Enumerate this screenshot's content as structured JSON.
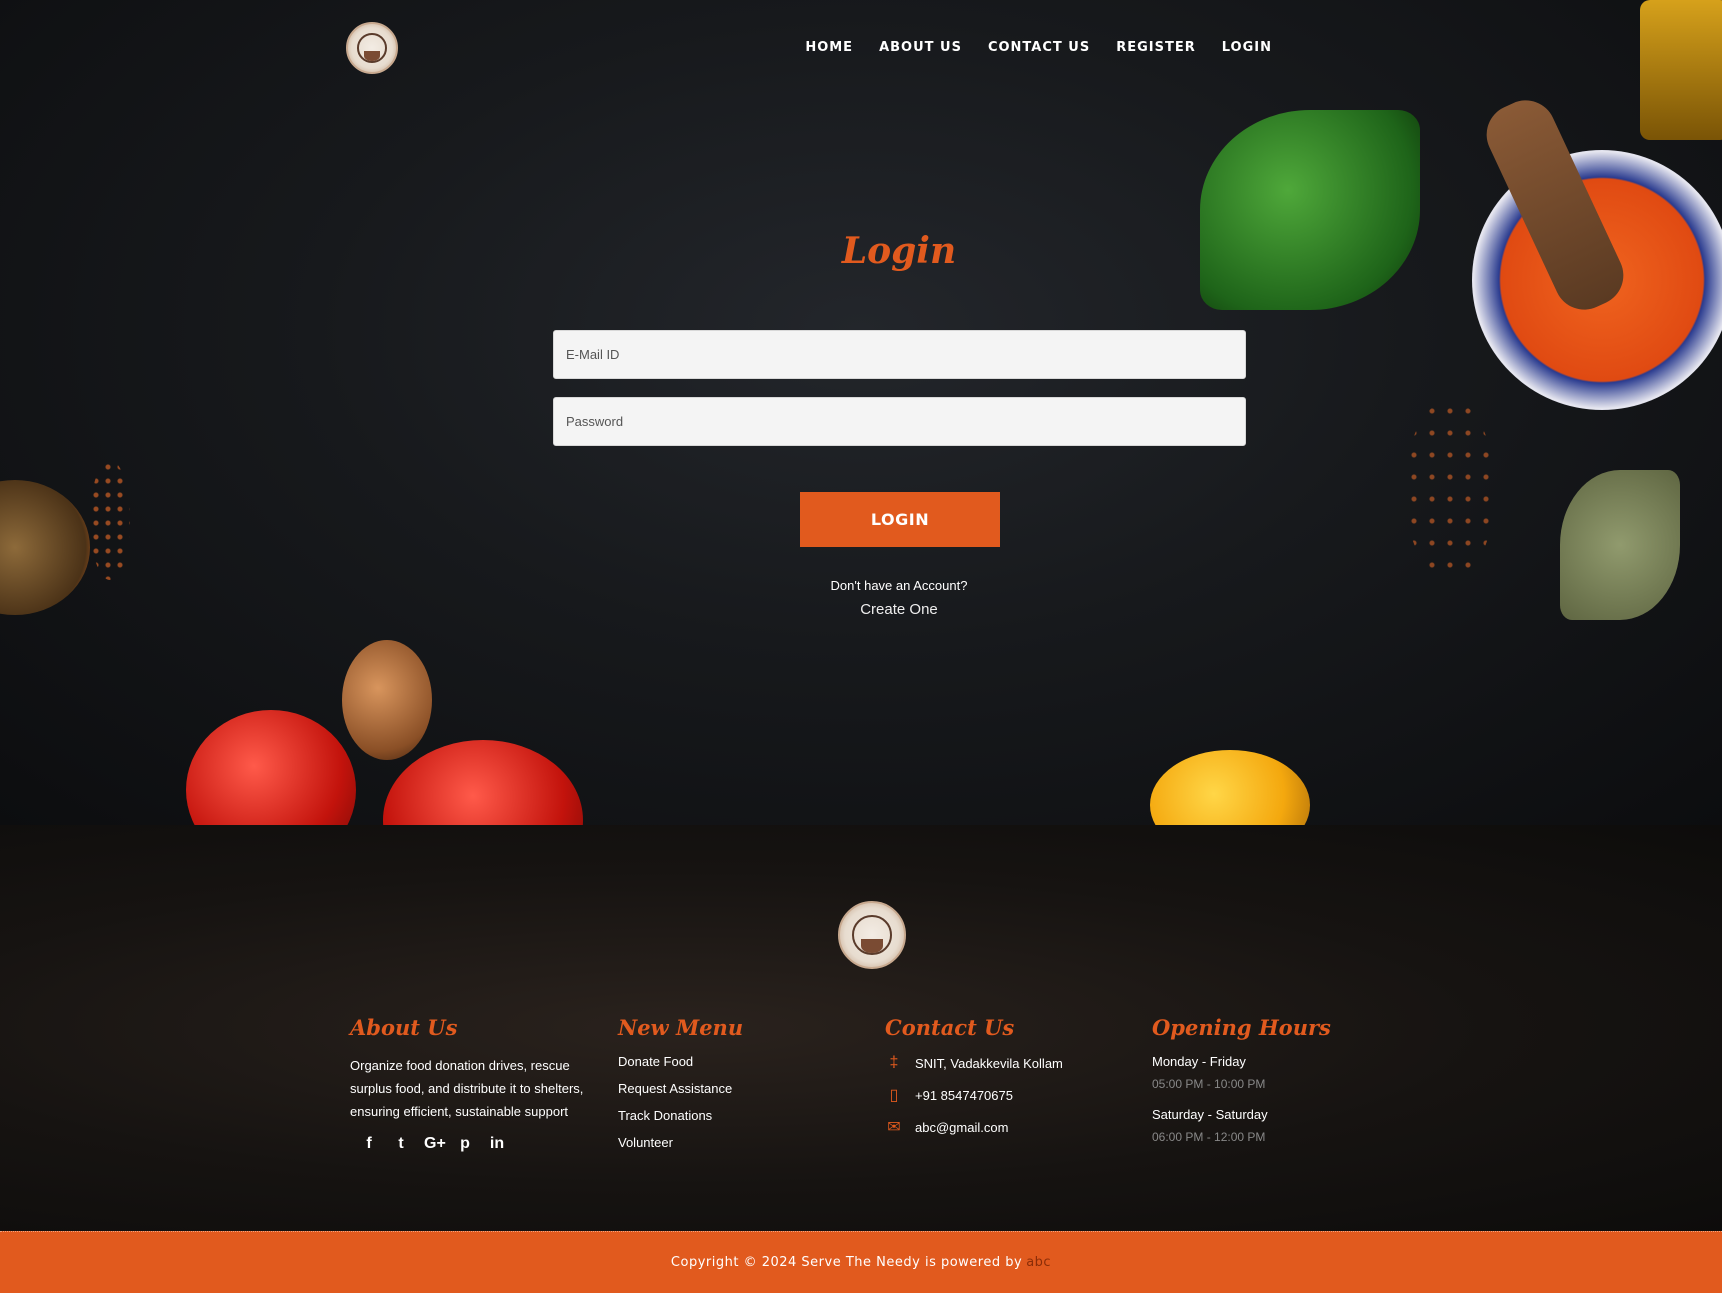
{
  "nav": {
    "items": [
      "HOME",
      "ABOUT US",
      "CONTACT US",
      "REGISTER",
      "LOGIN"
    ]
  },
  "login": {
    "title": "Login",
    "email_placeholder": "E-Mail ID",
    "password_placeholder": "Password",
    "button_label": "LOGIN",
    "no_account_text": "Don't have an Account?",
    "create_link": "Create One"
  },
  "footer": {
    "about": {
      "heading": "About Us",
      "text": "Organize food donation drives, rescue surplus food, and distribute it to shelters, ensuring efficient, sustainable support",
      "socials": [
        "f",
        "t",
        "G+",
        "p",
        "in"
      ]
    },
    "menu": {
      "heading": "New Menu",
      "items": [
        "Donate Food",
        "Request Assistance",
        "Track Donations",
        "Volunteer"
      ]
    },
    "contact": {
      "heading": "Contact Us",
      "address": "SNIT, Vadakkevila Kollam",
      "phone": "+91 8547470675",
      "email": "abc@gmail.com"
    },
    "hours": {
      "heading": "Opening Hours",
      "day1": "Monday - Friday",
      "time1": "05:00 PM - 10:00 PM",
      "day2": "Saturday - Saturday",
      "time2": "06:00 PM - 12:00 PM"
    },
    "copyright_text": "Copyright © 2024 Serve The Needy is powered by",
    "powered_by": "abc"
  },
  "colors": {
    "accent": "#e15a1e"
  },
  "icons": {
    "address": "signpost-icon",
    "phone": "mobile-icon",
    "email": "envelope-icon"
  }
}
